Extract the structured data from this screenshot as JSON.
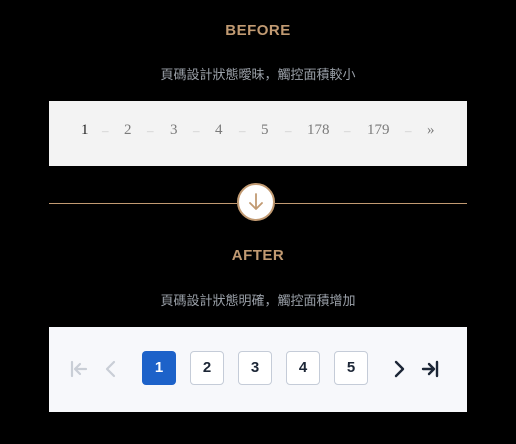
{
  "colors": {
    "accent": "#c19a72",
    "caption": "#9aa0a8",
    "old_text": "#7a7a7a",
    "old_active_text": "#222222",
    "new_text": "#1c2636",
    "active_blue": "#1d62c9",
    "disabled": "#c9ced6"
  },
  "before": {
    "title": "BEFORE",
    "caption": "頁碼設計狀態曖昧，觸控面積較小",
    "pages": [
      "1",
      "2",
      "3",
      "4",
      "5",
      "178",
      "179"
    ],
    "next_glyph": "»",
    "separator": "–"
  },
  "after": {
    "title": "AFTER",
    "caption": "頁碼設計狀態明確，觸控面積增加",
    "pages": [
      "1",
      "2",
      "3",
      "4",
      "5"
    ],
    "current_page": "1",
    "icons": [
      "first-page-icon",
      "previous-page-icon",
      "next-page-icon",
      "last-page-icon"
    ]
  },
  "transition_icon": "arrow-down-icon"
}
